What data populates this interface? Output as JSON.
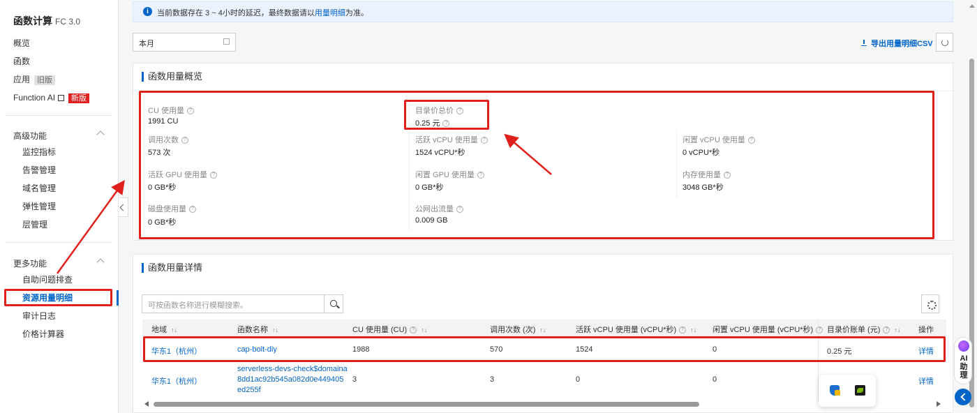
{
  "app": {
    "title": "函数计算",
    "version": "FC 3.0"
  },
  "sidebar": {
    "top_items": [
      {
        "label": "概览"
      },
      {
        "label": "函数"
      },
      {
        "label": "应用",
        "tag": "旧版"
      },
      {
        "label": "Function AI",
        "tag": "新版"
      }
    ],
    "advanced": {
      "label": "高级功能",
      "items": [
        "监控指标",
        "告警管理",
        "域名管理",
        "弹性管理",
        "层管理"
      ]
    },
    "more": {
      "label": "更多功能",
      "items": [
        "自助问题排查",
        "资源用量明细",
        "审计日志",
        "价格计算器"
      ],
      "active_index": 1
    }
  },
  "notice": {
    "text_before": "当前数据存在 3 ~ 4小时的延迟，最终数据请以",
    "link": "用量明细",
    "text_after": "为准。"
  },
  "toolbar": {
    "month_value": "本月",
    "export_label": "导出用量明细CSV"
  },
  "overview": {
    "title": "函数用量概览",
    "metrics": {
      "cu_usage": {
        "label": "CU 使用量",
        "value": "1991 CU"
      },
      "catalog_price": {
        "label": "目录价总价",
        "value": "0.25 元"
      },
      "invocations": {
        "label": "调用次数",
        "value": "573 次"
      },
      "active_vcpu": {
        "label": "活跃 vCPU 使用量",
        "value": "1524 vCPU*秒"
      },
      "idle_vcpu": {
        "label": "闲置 vCPU 使用量",
        "value": "0 vCPU*秒"
      },
      "active_gpu": {
        "label": "活跃 GPU 使用量",
        "value": "0 GB*秒"
      },
      "idle_gpu": {
        "label": "闲置 GPU 使用量",
        "value": "0 GB*秒"
      },
      "memory": {
        "label": "内存使用量",
        "value": "3048 GB*秒"
      },
      "disk": {
        "label": "磁盘使用量",
        "value": "0 GB*秒"
      },
      "egress": {
        "label": "公网出流量",
        "value": "0.009 GB"
      }
    }
  },
  "details": {
    "title": "函数用量详情",
    "search_placeholder": "可按函数名称进行模糊搜索。",
    "columns": {
      "region": "地域",
      "name": "函数名称",
      "cu": "CU 使用量 (CU)",
      "calls": "调用次数 (次)",
      "active_vcpu": "活跃 vCPU 使用量 (vCPU*秒)",
      "idle_vcpu": "闲置 vCPU 使用量 (vCPU*秒)",
      "bill": "目录价账单 (元)",
      "action": "操作"
    },
    "rows": [
      {
        "region": "华东1（杭州）",
        "name_line1": "cap-bolt-diy",
        "name_line2": "",
        "name_line3": "",
        "cu": "1988",
        "calls": "570",
        "active_vcpu": "1524",
        "idle_vcpu": "0",
        "bill": "0.25 元",
        "action": "详情"
      },
      {
        "region": "华东1（杭州）",
        "name_line1": "serverless-devs-check$domaina",
        "name_line2": "8dd1ac92b545a082d0e449405",
        "name_line3": "ed255f",
        "cu": "3",
        "calls": "3",
        "active_vcpu": "0",
        "idle_vcpu": "0",
        "bill": "",
        "action": "详情"
      }
    ]
  },
  "ai_helper": {
    "line1": "AI",
    "line2": "助",
    "line3": "理"
  },
  "colors": {
    "accent": "#0064c8",
    "annotation_red": "#e0201a"
  },
  "icons": [
    "info-icon",
    "calendar-icon",
    "download-icon",
    "refresh-icon",
    "help-icon",
    "search-icon",
    "settings-icon",
    "sort-icon",
    "external-link-icon",
    "chevron-up-icon",
    "chevron-left-icon",
    "shield-icon",
    "nvidia-icon",
    "ai-logo-icon"
  ]
}
